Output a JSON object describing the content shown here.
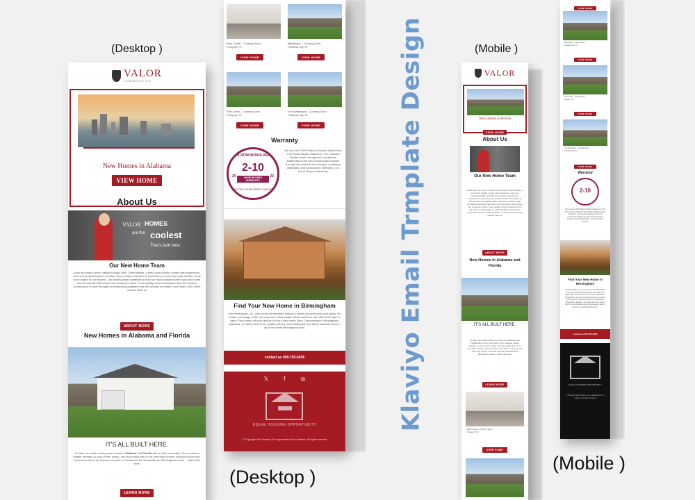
{
  "labels": {
    "desktop_top": "(Desktop )",
    "mobile_top": "(Mobile )",
    "desktop_bottom": "(Desktop )",
    "mobile_bottom": "(Mobile )",
    "vertical_title": "Klaviyo Email Trmplate Design"
  },
  "brand": {
    "logo_text": "VALOR",
    "logo_sub": "COMMUNITIES",
    "accent": "#a51b24",
    "title_color": "#6d9bd0"
  },
  "desktop1": {
    "hero_title": "New Homes in Alabama",
    "hero_button": "VIEW HOME",
    "about_heading": "About Us",
    "banner_brand": "VALOR",
    "banner_homes": "HOMES",
    "banner_are": "are the",
    "banner_coolest": "coolest",
    "banner_tag": "That's built here.",
    "team_heading": "Our New Home Team",
    "team_text": "Each and every home crafted through Valor Communities, a new home builder, comes with experience, care and professionalism. At Valor Communities, that kind of experience is more than just another credit to be added to our resume. Our leading team continues to build on that foundation with each new home and community that carries our company's name. From quality control measures from the onset of construction to walk throughs and warranty programs that are virtually unrivaled, more than 4,000 home owners have co",
    "about_more": "ABOUT MORE",
    "homes_heading": "New Homes in Alabama and Florida",
    "built_heading": "IT'S ALL BUILT HERE.",
    "built_p1": "At Valor, we build exciting new homes in ",
    "built_b1": "Alabama",
    "built_and": " and ",
    "built_b2": "Florida",
    "built_p2": " with a bold, fresh style. From massive master retreats, to cozy corner nooks, one stop inside any of our new Valor homes, and you'll soon see, when it comes to the best new homes in Florida and the Huntsville and Birmingham areas... that's built here.",
    "learn_more": "LEARN MORE"
  },
  "desktop2": {
    "listings": [
      {
        "name": "Bear Creek – Coming Soon",
        "city": "Freeport, FL",
        "button": "VIEW HOME"
      },
      {
        "name": "Martinique – Coming Soon",
        "city": "Panama City, FL",
        "button": "VIEW HOME"
      },
      {
        "name": "Fish Creek – Coming Soon",
        "city": "Freeport, FL",
        "button": "VIEW HOME"
      },
      {
        "name": "Fort Martinique – Coming Soon",
        "city": "Panama City, FL",
        "button": "VIEW HOME"
      }
    ],
    "warranty_heading": "Warranty",
    "badge_top": "PLATINUM BUILDER",
    "badge_num": "2-10",
    "badge_mid": "HOME BUYERS WARRANTY",
    "badge_y1": "20",
    "badge_y2": "23",
    "badge_bottom": "BUILDER ACHIEVEMENT AWARDS",
    "warranty_text": "We won the 2023 Platinum Builder Award from 2-10 Home Buyers Warranty! The Platinum Builder Award recognizes exceptional leadership in the new construction industry through innovative home designs, marketing strategies, and construction methods. 2-10 Home Buyers Warranty!",
    "cutaway_caption": "",
    "find_heading": "Find Your New Home in Birmingham",
    "find_text": "Our Birmingham, AL, new home communities feature a variety of home sizes and styles. No matter your stage of life, we have new home builder ideal homes for sale with more style or value. Feel every unit your decide to buy a new home Valor Communities in Birmingham, Alabama, we stand behind the quality with the most dedicated new home warranty team in all of the metro Birmingham area.",
    "contact": "contact us 000-750-6036",
    "social": [
      "𝕏",
      "f",
      "◎"
    ],
    "equal_housing": "EQUAL HOUSING OPPORTUNITY",
    "footer_text": "© Copyright Valor Homes | Our organization info | Address | All rights reserved"
  },
  "mobile1": {
    "hero_title": "New Homes in Florida",
    "hero_button": "VIEW HOME",
    "about_heading": "About Us",
    "team_heading": "Our New Home Team",
    "team_text": "Each and every home crafted through Valor Communities, a new home builder, comes with experience, care and professionalism. At Valor Communities, that kind of experience is more than just another credit to be added to our resume. Our leading team continues to build on that foundation with each new home and community that carries our company's name. From quality control measures from the onset of construction to walk throughs and warranty programs that are virtually unrivaled, more than 4,000 home owners have co",
    "about_more": "ABOUT MORE",
    "homes_heading": "New Homes in Alabama and Florida",
    "built_heading": "IT'S ALL BUILT HERE.",
    "built_text": "At Valor, we build exciting new homes in Alabama and Florida with a bold, fresh style. From massive master retreats, to cozy corner nooks, one stop inside any of our new Valor homes, and you'll soon see, when it comes to the best new homes in Florida and the Huntsville and Birmingham areas... that's built here.",
    "learn_more": "LEARN MORE",
    "listing_name": "Bear Creek – Coming Soon",
    "listing_city": "Freeport, FL",
    "listing_button": "VIEW HOME"
  },
  "mobile2": {
    "top_button": "VIEW HOME",
    "listings": [
      {
        "name": "Martinique – Coming Soon",
        "city": "Panama City, FL",
        "button": "VIEW HOME"
      },
      {
        "name": "Fish Creek – Coming Soon",
        "city": "Freeport, FL",
        "button": "VIEW HOME"
      },
      {
        "name": "Fort Martinique – Coming Soon",
        "city": "Panama City, FL",
        "button": "VIEW HOME"
      }
    ],
    "warranty_heading": "Warranty",
    "badge_num": "2-10",
    "warranty_text": "We won the 2023 Platinum Builder Award from 2-10 Home Buyers Warranty! The Platinum Builder Award recognizes exceptional leadership in the new construction industry through innovative home designs, marketing strategies, and construction methods.",
    "find_heading": "Find Your New Home in Birmingham",
    "find_text": "Our Birmingham, AL, new home communities feature a variety of home sizes and styles. No matter your stage of life, we have new home builder ideal homes for sale with more style or value. Feel every unit your decide to buy a new home Valor Communities in Birmingham, Alabama, we stand behind the quality with the most dedicated new home warranty team in all of the metro Birmingham area.",
    "contact": "contact us 000-750-6036",
    "equal_housing": "EQUAL HOUSING OPPORTUNITY",
    "footer_text": "© Copyright Valor Homes | Our organization info | Address | All rights reserved"
  }
}
